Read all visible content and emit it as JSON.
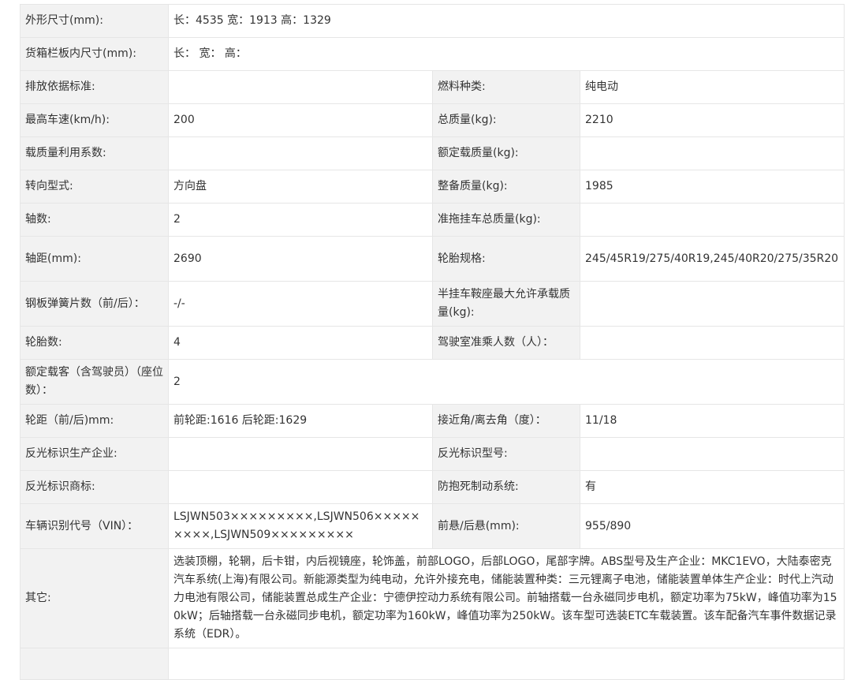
{
  "rows": [
    {
      "label": "外形尺寸(mm):",
      "value": "长：4535 宽：1913 高：1329"
    },
    {
      "label": "货箱栏板内尺寸(mm):",
      "value": "长：  宽：  高："
    },
    {
      "l1": "排放依据标准:",
      "v1": "",
      "l2": "燃料种类:",
      "v2": "纯电动"
    },
    {
      "l1": "最高车速(km/h):",
      "v1": "200",
      "l2": "总质量(kg):",
      "v2": "2210"
    },
    {
      "l1": "载质量利用系数:",
      "v1": "",
      "l2": "额定载质量(kg):",
      "v2": ""
    },
    {
      "l1": "转向型式:",
      "v1": "方向盘",
      "l2": "整备质量(kg):",
      "v2": "1985"
    },
    {
      "l1": "轴数:",
      "v1": "2",
      "l2": "准拖挂车总质量(kg):",
      "v2": ""
    },
    {
      "l1": "轴距(mm):",
      "v1": "2690",
      "l2": "轮胎规格:",
      "v2": "245/45R19/275/40R19,245/40R20/275/35R20"
    },
    {
      "l1": "钢板弹簧片数（前/后）：",
      "v1": "-/-",
      "l2": "半挂车鞍座最大允许承载质量(kg):",
      "v2": ""
    },
    {
      "l1": "轮胎数:",
      "v1": "4",
      "l2": "驾驶室准乘人数（人）：",
      "v2": ""
    },
    {
      "label": "额定载客（含驾驶员）（座位数）：",
      "value": "2"
    },
    {
      "l1": "轮距（前/后)mm:",
      "v1": "前轮距:1616 后轮距:1629",
      "l2": "接近角/离去角（度）：",
      "v2": "11/18"
    },
    {
      "l1": "反光标识生产企业:",
      "v1": "",
      "l2": "反光标识型号:",
      "v2": ""
    },
    {
      "l1": "反光标识商标:",
      "v1": "",
      "l2": "防抱死制动系统:",
      "v2": "有"
    },
    {
      "l1": "车辆识别代号（VIN）：",
      "v1": "LSJWN503×××××××××,LSJWN506×××××××××,LSJWN509×××××××××",
      "l2": "前悬/后悬(mm):",
      "v2": "955/890"
    },
    {
      "label": "其它:",
      "value": "选装顶棚，轮辋，后卡钳，内后视镜座，轮饰盖，前部LOGO，后部LOGO，尾部字牌。ABS型号及生产企业：MKC1EVO，大陆泰密克汽车系统(上海)有限公司。新能源类型为纯电动，允许外接充电，储能装置种类：三元锂离子电池，储能装置单体生产企业：时代上汽动力电池有限公司，储能装置总成生产企业：宁德伊控动力系统有限公司。前轴搭载一台永磁同步电机，额定功率为75kW，峰值功率为150kW；后轴搭载一台永磁同步电机，额定功率为160kW，峰值功率为250kW。该车型可选装ETC车载装置。该车配备汽车事件数据记录系统（EDR）。"
    },
    {
      "label": "",
      "value": ""
    }
  ]
}
